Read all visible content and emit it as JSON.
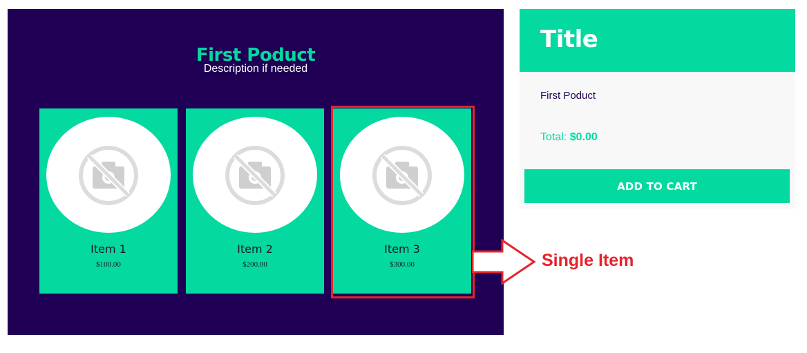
{
  "product": {
    "title": "First Poduct",
    "description": "Description if needed",
    "items": [
      {
        "name": "Item 1",
        "price": "$100.00",
        "image_icon": "no-image-camera-icon"
      },
      {
        "name": "Item 2",
        "price": "$200.00",
        "image_icon": "no-image-camera-icon"
      },
      {
        "name": "Item 3",
        "price": "$300.00",
        "image_icon": "no-image-camera-icon"
      }
    ]
  },
  "annotation": {
    "label": "Single Item",
    "color": "#e4242b"
  },
  "cart": {
    "title": "Title",
    "product_name": "First Poduct",
    "total_label": "Total:",
    "total_value": "$0.00",
    "add_button_label": "ADD TO CART"
  },
  "colors": {
    "panel_background": "#1f0055",
    "accent": "#04d9a0",
    "cart_background": "#f8f8f8",
    "highlight": "#e4242b"
  }
}
